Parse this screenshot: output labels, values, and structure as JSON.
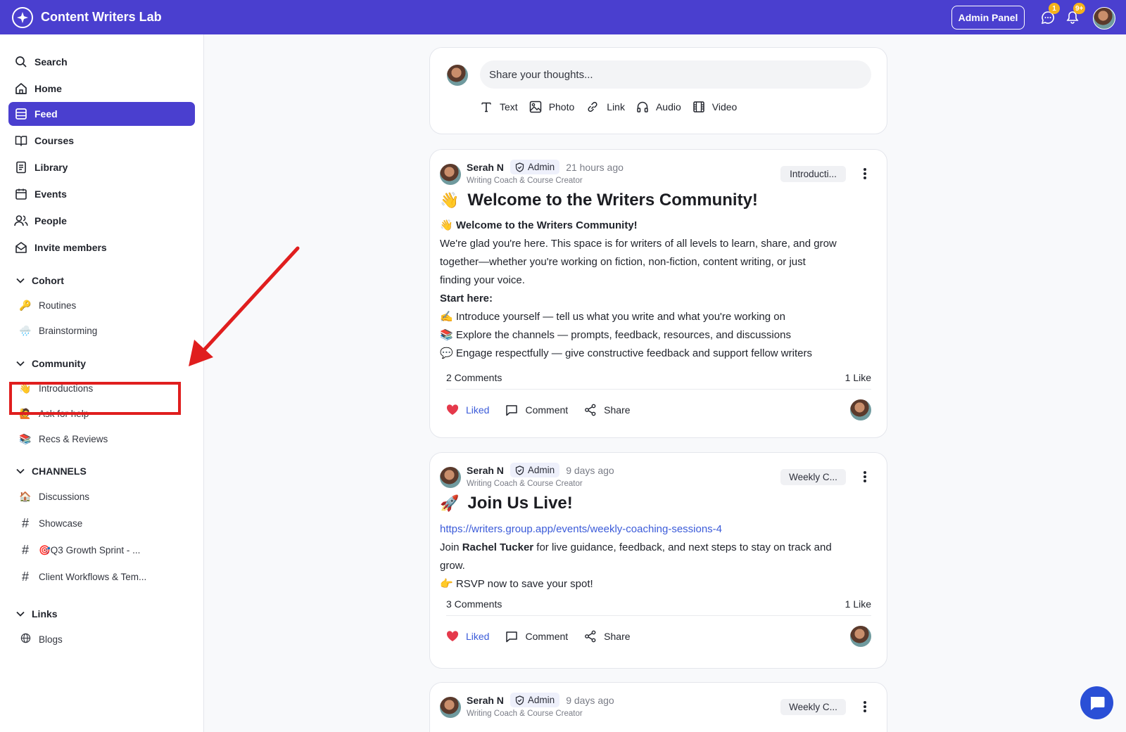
{
  "app": {
    "title": "Content Writers Lab"
  },
  "topbar": {
    "admin_label": "Admin Panel",
    "messages_badge": "1",
    "notifications_badge": "9+"
  },
  "sidebar": {
    "nav": [
      {
        "label": "Search",
        "icon": "search-icon"
      },
      {
        "label": "Home",
        "icon": "home-icon"
      },
      {
        "label": "Feed",
        "icon": "feed-icon",
        "active": true
      },
      {
        "label": "Courses",
        "icon": "book-icon"
      },
      {
        "label": "Library",
        "icon": "library-icon"
      },
      {
        "label": "Events",
        "icon": "calendar-icon"
      },
      {
        "label": "People",
        "icon": "people-icon"
      },
      {
        "label": "Invite members",
        "icon": "envelope-icon"
      }
    ],
    "sections": [
      {
        "title": "Cohort",
        "items": [
          {
            "emoji": "🔑",
            "label": "Routines"
          },
          {
            "emoji": "🌧️",
            "label": "Brainstorming"
          }
        ]
      },
      {
        "title": "Community",
        "items": [
          {
            "emoji": "👋",
            "label": "Introductions"
          },
          {
            "emoji": "🙋",
            "label": "Ask for help"
          },
          {
            "emoji": "📚",
            "label": "Recs & Reviews"
          }
        ]
      },
      {
        "title": "CHANNELS",
        "items": [
          {
            "emoji": "🏠",
            "label": "Discussions"
          },
          {
            "emoji": "#",
            "label": "Showcase"
          },
          {
            "emoji": "#",
            "label": "🎯Q3 Growth Sprint - ..."
          },
          {
            "emoji": "#",
            "label": "Client Workflows & Tem..."
          }
        ]
      },
      {
        "title": "Links",
        "items": [
          {
            "emoji": "🌐",
            "label": "Blogs"
          }
        ]
      }
    ]
  },
  "composer": {
    "placeholder": "Share your thoughts...",
    "types": [
      "Text",
      "Photo",
      "Link",
      "Audio",
      "Video"
    ]
  },
  "posts": [
    {
      "author": "Serah N",
      "badge": "Admin",
      "time": "21 hours ago",
      "role": "Writing Coach & Course Creator",
      "space": "Introducti...",
      "title_emoji": "👋",
      "title": "Welcome to the Writers Community!",
      "body": {
        "heading_emoji": "👋",
        "heading": "Welcome to the Writers Community!",
        "paragraph_1": "We're glad you're here. This space is for writers of all levels to learn, share, and grow",
        "paragraph_2": "together—whether you're working on fiction, non-fiction, content writing, or just",
        "paragraph_3": "finding your voice.",
        "start": "Start here:",
        "bullets": [
          {
            "emoji": "✍️",
            "text": "Introduce yourself — tell us what you write and what you're working on"
          },
          {
            "emoji": "📚",
            "text": "Explore the channels — prompts, feedback, resources, and discussions"
          },
          {
            "emoji": "💬",
            "text": "Engage respectfully — give constructive feedback and support fellow writers"
          }
        ]
      },
      "comments": "2 Comments",
      "likes": "1 Like",
      "actions": {
        "liked": "Liked",
        "comment": "Comment",
        "share": "Share"
      }
    },
    {
      "author": "Serah N",
      "badge": "Admin",
      "time": "9 days ago",
      "role": "Writing Coach & Course Creator",
      "space": "Weekly C...",
      "title_emoji": "🚀",
      "title": "Join Us Live!",
      "body": {
        "link": "https://writers.group.app/events/weekly-coaching-sessions-4",
        "join_pre": "Join ",
        "join_name": "Rachel Tucker",
        "join_post": " for live guidance, feedback, and next steps to stay on track and",
        "join_line2": "grow.",
        "rsvp_emoji": "👉",
        "rsvp": "RSVP now to save your spot!"
      },
      "comments": "3 Comments",
      "likes": "1 Like",
      "actions": {
        "liked": "Liked",
        "comment": "Comment",
        "share": "Share"
      }
    },
    {
      "author": "Serah N",
      "badge": "Admin",
      "time": "9 days ago",
      "role": "Writing Coach & Course Creator",
      "space": "Weekly C..."
    }
  ],
  "colors": {
    "brand": "#4a3fcf",
    "highlight": "#e01e1e",
    "link": "#3b5bd9",
    "like": "#e5394b"
  }
}
